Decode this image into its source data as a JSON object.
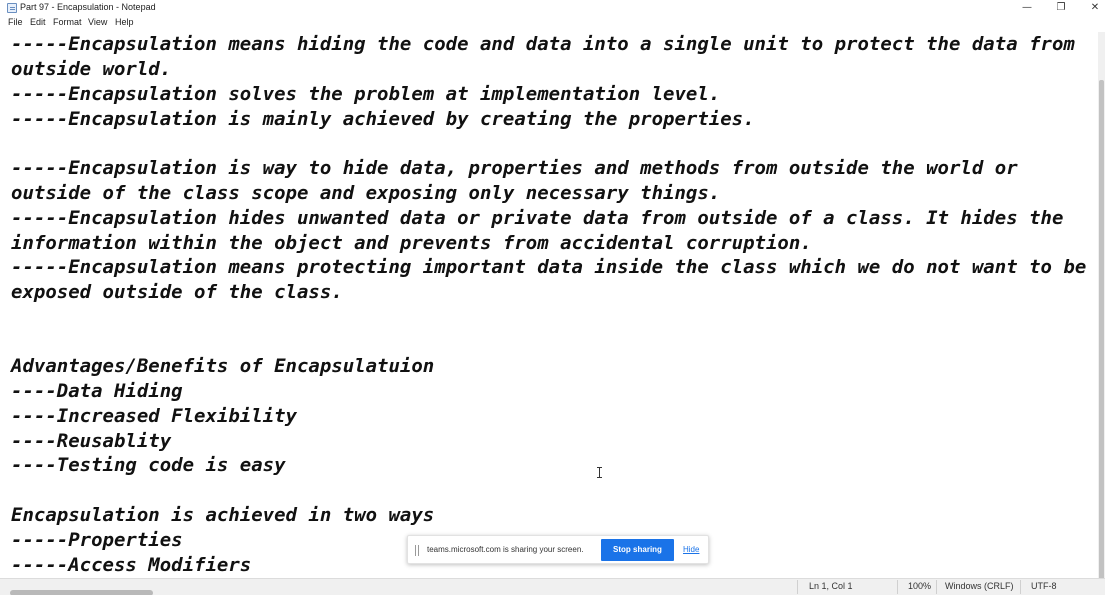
{
  "window": {
    "title": "Part 97 - Encapsulation - Notepad",
    "minimize_icon": "minimize-icon",
    "maximize_icon": "restore-icon",
    "close_icon": "close-icon"
  },
  "menu": [
    "File",
    "Edit",
    "Format",
    "View",
    "Help"
  ],
  "editor": {
    "lines": [
      "-----Encapsulation means hiding the code and data into a single unit to protect the data from",
      "outside world.",
      "-----Encapsulation solves the problem at implementation level.",
      "-----Encapsulation is mainly achieved by creating the properties.",
      "",
      "-----Encapsulation is way to hide data, properties and methods from outside the world or",
      "outside of the class scope and exposing only necessary things.",
      "-----Encapsulation hides unwanted data or private data from outside of a class. It hides the",
      "information within the object and prevents from accidental corruption.",
      "-----Encapsulation means protecting important data inside the class which we do not want to be",
      "exposed outside of the class.",
      "",
      "",
      "Advantages/Benefits of Encapsulatuion",
      "----Data Hiding",
      "----Increased Flexibility",
      "----Reusablity",
      "----Testing code is easy",
      "",
      "Encapsulation is achieved in two ways",
      "-----Properties",
      "-----Access Modifiers"
    ]
  },
  "status": {
    "position": "Ln 1, Col 1",
    "zoom": "100%",
    "line_ending": "Windows (CRLF)",
    "encoding": "UTF-8"
  },
  "share_bar": {
    "message": "teams.microsoft.com is sharing your screen.",
    "stop_label": "Stop sharing",
    "hide_label": "Hide",
    "accent": "#1a73e8"
  }
}
